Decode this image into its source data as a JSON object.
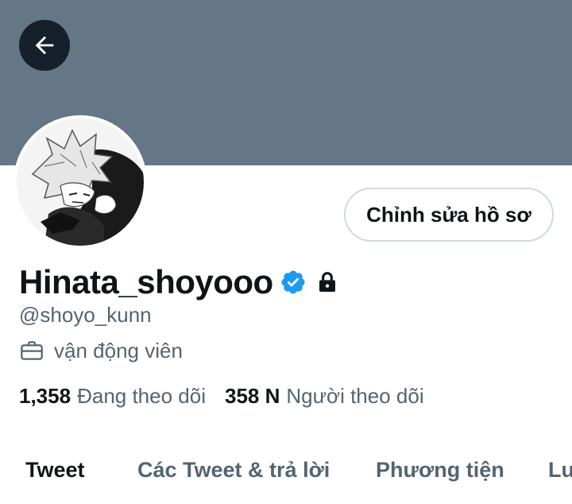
{
  "profile": {
    "display_name": "Hinata_shoyooo",
    "handle": "@shoyo_kunn",
    "job": "vận động viên",
    "following_count": "1,358",
    "following_label": "Đang theo dõi",
    "followers_count": "358 N",
    "followers_label": "Người theo dõi"
  },
  "actions": {
    "edit_profile_label": "Chỉnh sửa hồ sơ"
  },
  "tabs": [
    {
      "label": "Tweet",
      "active": true
    },
    {
      "label": "Các Tweet & trả lời",
      "active": false
    },
    {
      "label": "Phương tiện",
      "active": false
    },
    {
      "label": "Lu",
      "active": false
    }
  ],
  "colors": {
    "banner": "#657686",
    "verified": "#1d9bf0",
    "secondary_text": "#536471",
    "primary_text": "#0f1419"
  },
  "icons": {
    "back": "arrow-left-icon",
    "verified": "verified-badge-icon",
    "lock": "lock-icon",
    "job": "briefcase-icon"
  }
}
